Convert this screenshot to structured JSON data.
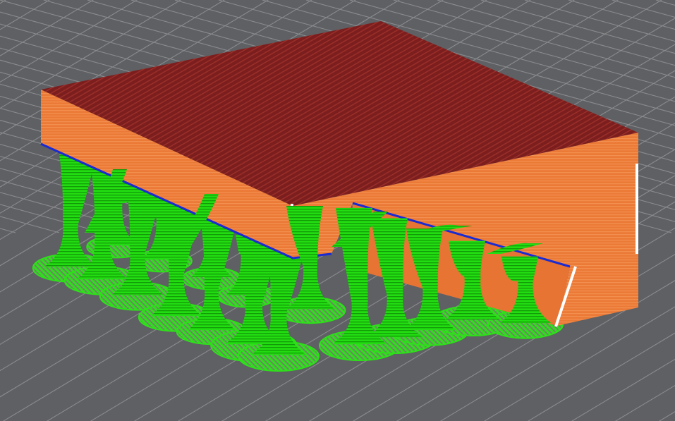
{
  "viewer": {
    "background_color": "#5f6063",
    "grid_line_color": "#8a8b8e",
    "icons": [
      "build-plate-grid-icon"
    ]
  },
  "model": {
    "top_surface_color": "#7c1e1e",
    "top_surface_stripe_color": "#a13a30",
    "side_wall_color": "#ec7a37",
    "side_wall_stripe_color": "#f59b5c",
    "interface_edge_color": "#1a2bd1",
    "seam_color": "#ffffff"
  },
  "supports": {
    "type": "tree",
    "color": "#22dd11",
    "shadow_color": "#0e8e06",
    "base_ring_color": "#6a8f60"
  }
}
